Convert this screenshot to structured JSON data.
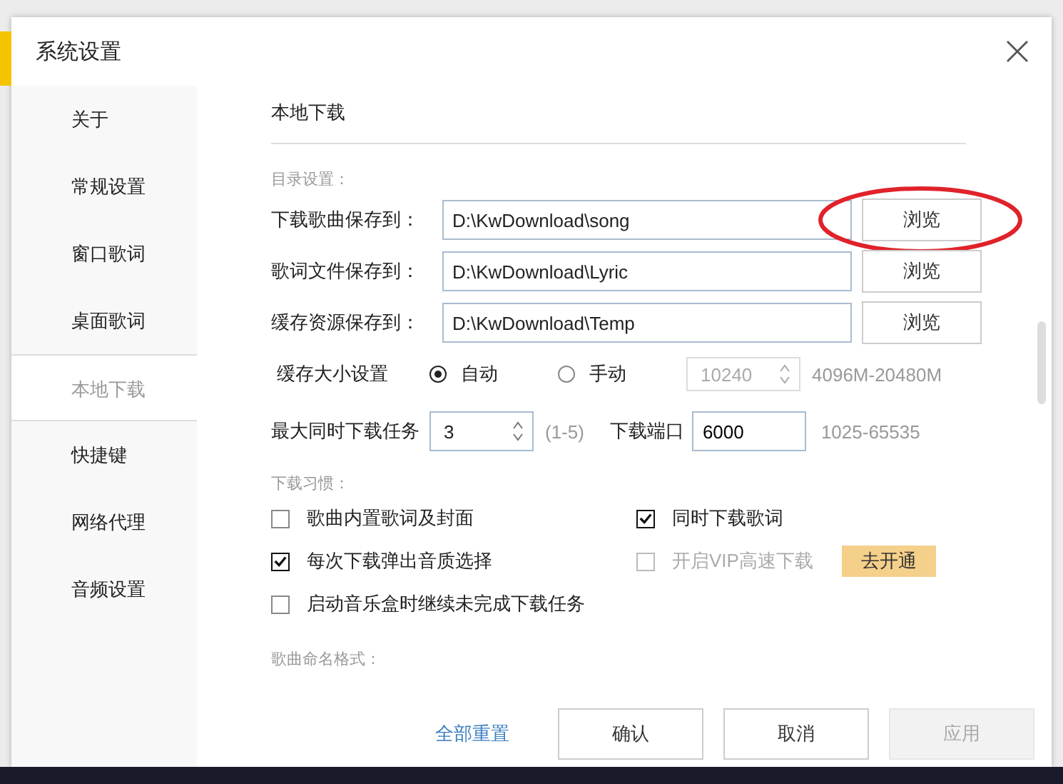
{
  "window": {
    "title": "系统设置"
  },
  "sidebar": {
    "items": [
      {
        "label": "关于",
        "selected": false
      },
      {
        "label": "常规设置",
        "selected": false
      },
      {
        "label": "窗口歌词",
        "selected": false
      },
      {
        "label": "桌面歌词",
        "selected": false
      },
      {
        "label": "本地下载",
        "selected": true
      },
      {
        "label": "快捷键",
        "selected": false
      },
      {
        "label": "网络代理",
        "selected": false
      },
      {
        "label": "音频设置",
        "selected": false
      }
    ]
  },
  "section_title": "本地下载",
  "directory": {
    "heading": "目录设置：",
    "rows": [
      {
        "label": "下载歌曲保存到：",
        "value": "D:\\KwDownload\\song",
        "button": "浏览",
        "annotated": true
      },
      {
        "label": "歌词文件保存到：",
        "value": "D:\\KwDownload\\Lyric",
        "button": "浏览",
        "annotated": false
      },
      {
        "label": "缓存资源保存到：",
        "value": "D:\\KwDownload\\Temp",
        "button": "浏览",
        "annotated": false
      }
    ]
  },
  "cache": {
    "label": "缓存大小设置",
    "options": [
      {
        "label": "自动",
        "selected": true
      },
      {
        "label": "手动",
        "selected": false
      }
    ],
    "size": {
      "value": "10240",
      "disabled": true
    },
    "range": "4096M-20480M"
  },
  "tasks": {
    "label": "最大同时下载任务",
    "value": "3",
    "range": "(1-5)",
    "port_label": "下载端口",
    "port_value": "6000",
    "port_range": "1025-65535"
  },
  "habits": {
    "heading": "下载习惯：",
    "options": [
      {
        "label": "歌曲内置歌词及封面",
        "checked": false,
        "disabled": false
      },
      {
        "label": "同时下载歌词",
        "checked": true,
        "disabled": false
      },
      {
        "label": "每次下载弹出音质选择",
        "checked": true,
        "disabled": false
      },
      {
        "label": "开启VIP高速下载",
        "checked": false,
        "disabled": true,
        "action": "去开通"
      },
      {
        "label": "启动音乐盒时继续未完成下载任务",
        "checked": false,
        "disabled": false
      }
    ]
  },
  "naming": {
    "heading": "歌曲命名格式："
  },
  "footer": {
    "reset": "全部重置",
    "buttons": [
      {
        "label": "确认",
        "disabled": false
      },
      {
        "label": "取消",
        "disabled": false
      },
      {
        "label": "应用",
        "disabled": true
      }
    ]
  }
}
